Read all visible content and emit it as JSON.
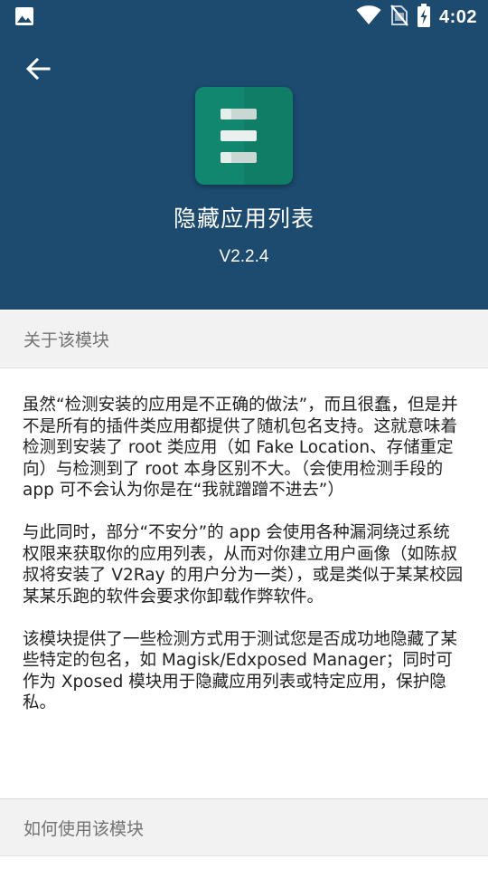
{
  "status_bar": {
    "time": "4:02",
    "left_icon": "image-icon",
    "icons": [
      "wifi-icon",
      "no-sim-icon",
      "battery-charging-icon"
    ]
  },
  "header": {
    "back_icon": "arrow-back-icon",
    "app_icon": "list-icon",
    "title": "隐藏应用列表",
    "version": "V2.2.4",
    "background_color": "#1d4a6f"
  },
  "sections": [
    {
      "title": "关于该模块",
      "paragraphs": [
        "虽然“检测安装的应用是不正确的做法”，而且很蠢，但是并不是所有的插件类应用都提供了随机包名支持。这就意味着检测到安装了 root 类应用（如 Fake Location、存储重定向）与检测到了 root 本身区别不大。（会使用检测手段的 app 可不会认为你是在“我就蹭蹭不进去”）",
        "与此同时，部分“不安分”的 app 会使用各种漏洞绕过系统权限来获取你的应用列表，从而对你建立用户画像（如陈叔叔将安装了 V2Ray 的用户分为一类），或是类似于某某校园某某乐跑的软件会要求你卸载作弊软件。",
        "该模块提供了一些检测方式用于测试您是否成功地隐藏了某些特定的包名，如 Magisk/Edxposed Manager；同时可作为 Xposed 模块用于隐藏应用列表或特定应用，保护隐私。"
      ]
    },
    {
      "title": "如何使用该模块"
    }
  ]
}
